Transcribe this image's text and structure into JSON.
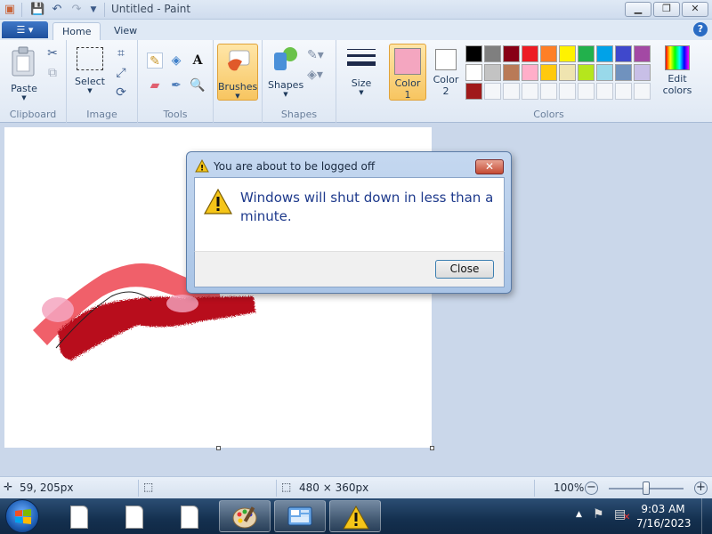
{
  "window": {
    "title": "Untitled - Paint",
    "minimize_icon": "minimize-icon",
    "maximize_icon": "restore-icon",
    "close_icon": "close-icon"
  },
  "quick_access": {
    "icons": [
      "save-icon",
      "undo-icon",
      "redo-icon",
      "dropdown-arrow-icon"
    ]
  },
  "ribbon": {
    "tabs": [
      {
        "label": "Home",
        "active": true
      },
      {
        "label": "View",
        "active": false
      }
    ],
    "help_label": "?",
    "groups": {
      "clipboard": {
        "label": "Clipboard",
        "paste": "Paste"
      },
      "image": {
        "label": "Image",
        "select": "Select"
      },
      "tools": {
        "label": "Tools"
      },
      "brushes": {
        "label": "Brushes"
      },
      "shapes": {
        "label": "Shapes",
        "shapes_btn": "Shapes"
      },
      "size": {
        "label": "Size"
      },
      "colors": {
        "label": "Colors",
        "color1_line1": "Color",
        "color1_line2": "1",
        "color2_line1": "Color",
        "color2_line2": "2",
        "edit_line1": "Edit",
        "edit_line2": "colors",
        "color1_value": "#f4a6c0",
        "color2_value": "#ffffff",
        "palette": [
          "#000000",
          "#7f7f7f",
          "#880015",
          "#ed1c24",
          "#ff7f27",
          "#fff200",
          "#22b14c",
          "#00a2e8",
          "#3f48cc",
          "#a349a4",
          "#ffffff",
          "#c3c3c3",
          "#b97a57",
          "#ffaec9",
          "#ffc90e",
          "#efe4b0",
          "#b5e61d",
          "#99d9ea",
          "#7092be",
          "#c8bfe7",
          "#a01a1a",
          "#ffffff",
          "#ffffff",
          "#ffffff",
          "#ffffff",
          "#ffffff",
          "#ffffff",
          "#ffffff",
          "#ffffff",
          "#ffffff"
        ]
      }
    }
  },
  "dialog": {
    "title": "You are about to be logged off",
    "message": "Windows will shut down in less than a minute.",
    "close_button": "Close",
    "close_x": "✕"
  },
  "statusbar": {
    "cursor_pos": "59, 205px",
    "image_size": "480 × 360px",
    "zoom": "100%"
  },
  "taskbar": {
    "time": "9:03 AM",
    "date": "7/16/2023"
  }
}
